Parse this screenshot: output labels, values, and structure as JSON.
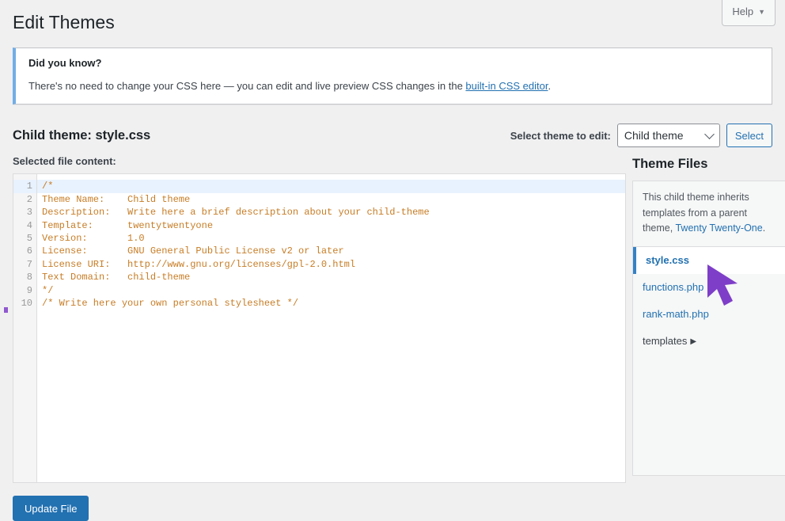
{
  "help_tab": {
    "label": "Help",
    "caret_icon": "chevron-down-icon"
  },
  "page": {
    "title": "Edit Themes"
  },
  "notice": {
    "title": "Did you know?",
    "text_before": "There's no need to change your CSS here — you can edit and live preview CSS changes in the ",
    "link_label": "built-in CSS editor",
    "text_after": "."
  },
  "fileedit": {
    "file_title": "Child theme: style.css",
    "theme_select_label": "Select theme to edit:",
    "theme_select_value": "Child theme",
    "theme_select_options": [
      "Child theme"
    ],
    "select_button": "Select",
    "content_label": "Selected file content:",
    "update_button": "Update File"
  },
  "editor": {
    "active_line": 1,
    "lines": [
      "/*",
      "Theme Name:    Child theme",
      "Description:   Write here a brief description about your child-theme",
      "Template:      twentytwentyone",
      "Version:       1.0",
      "License:       GNU General Public License v2 or later",
      "License URI:   http://www.gnu.org/licenses/gpl-2.0.html",
      "Text Domain:   child-theme",
      "*/",
      "/* Write here your own personal stylesheet */"
    ],
    "line_numbers": [
      "1",
      "2",
      "3",
      "4",
      "5",
      "6",
      "7",
      "8",
      "9",
      "10"
    ]
  },
  "sidebar": {
    "title": "Theme Files",
    "intro_before": "This child theme inherits templates from a parent theme, ",
    "intro_link": "Twenty Twenty-One",
    "intro_after": ".",
    "files": [
      {
        "label": "style.css",
        "current": true,
        "type": "file"
      },
      {
        "label": "functions.php",
        "current": false,
        "type": "file"
      },
      {
        "label": "rank-math.php",
        "current": false,
        "type": "file"
      },
      {
        "label": "templates",
        "current": false,
        "type": "folder",
        "icon": "triangle-right-icon"
      }
    ]
  },
  "colors": {
    "accent": "#2271b1",
    "notice_border": "#72aee6",
    "code_text": "#c77d26",
    "active_line": "#e8f2fe",
    "cursor": "#7e3ec8"
  }
}
